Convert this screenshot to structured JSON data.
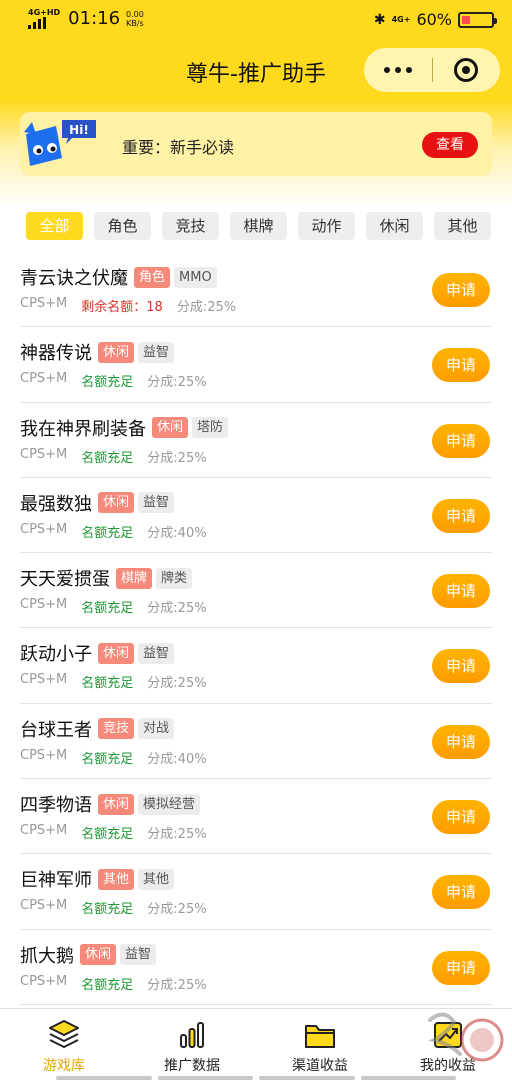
{
  "status_bar": {
    "network_label": "4G+HD",
    "time": "01:16",
    "speed_value": "0.00",
    "speed_unit": "KB/s",
    "right_network": "4G+",
    "battery_percent": "60%",
    "battery_level": 0.3
  },
  "nav": {
    "title": "尊牛-推广助手"
  },
  "notice": {
    "mascot_text": "Hi!",
    "text": "重要：新手必读",
    "button_label": "查看"
  },
  "tabs": [
    {
      "label": "全部",
      "active": true
    },
    {
      "label": "角色",
      "active": false
    },
    {
      "label": "竞技",
      "active": false
    },
    {
      "label": "棋牌",
      "active": false
    },
    {
      "label": "动作",
      "active": false
    },
    {
      "label": "休闲",
      "active": false
    },
    {
      "label": "其他",
      "active": false
    }
  ],
  "games": [
    {
      "name": "青云诀之伏魔",
      "category": "角色",
      "tag": "MMO",
      "model": "CPS+M",
      "quota": "剩余名额：18",
      "quota_status": "warn",
      "share": "分成:25%",
      "button": "申请"
    },
    {
      "name": "神器传说",
      "category": "休闲",
      "tag": "益智",
      "model": "CPS+M",
      "quota": "名额充足",
      "quota_status": "ok",
      "share": "分成:25%",
      "button": "申请"
    },
    {
      "name": "我在神界刷装备",
      "category": "休闲",
      "tag": "塔防",
      "model": "CPS+M",
      "quota": "名额充足",
      "quota_status": "ok",
      "share": "分成:25%",
      "button": "申请"
    },
    {
      "name": "最强数独",
      "category": "休闲",
      "tag": "益智",
      "model": "CPS+M",
      "quota": "名额充足",
      "quota_status": "ok",
      "share": "分成:40%",
      "button": "申请"
    },
    {
      "name": "天天爱掼蛋",
      "category": "棋牌",
      "tag": "牌类",
      "model": "CPS+M",
      "quota": "名额充足",
      "quota_status": "ok",
      "share": "分成:25%",
      "button": "申请"
    },
    {
      "name": "跃动小子",
      "category": "休闲",
      "tag": "益智",
      "model": "CPS+M",
      "quota": "名额充足",
      "quota_status": "ok",
      "share": "分成:25%",
      "button": "申请"
    },
    {
      "name": "台球王者",
      "category": "竞技",
      "tag": "对战",
      "model": "CPS+M",
      "quota": "名额充足",
      "quota_status": "ok",
      "share": "分成:40%",
      "button": "申请"
    },
    {
      "name": "四季物语",
      "category": "休闲",
      "tag": "模拟经营",
      "model": "CPS+M",
      "quota": "名额充足",
      "quota_status": "ok",
      "share": "分成:25%",
      "button": "申请"
    },
    {
      "name": "巨神军师",
      "category": "其他",
      "tag": "其他",
      "model": "CPS+M",
      "quota": "名额充足",
      "quota_status": "ok",
      "share": "分成:25%",
      "button": "申请"
    },
    {
      "name": "抓大鹅",
      "category": "休闲",
      "tag": "益智",
      "model": "CPS+M",
      "quota": "名额充足",
      "quota_status": "ok",
      "share": "分成:25%",
      "button": "申请"
    }
  ],
  "tabbar": [
    {
      "label": "游戏库",
      "icon": "stack-icon",
      "active": true
    },
    {
      "label": "推广数据",
      "icon": "bar-chart-icon",
      "active": false
    },
    {
      "label": "渠道收益",
      "icon": "folder-icon",
      "active": false
    },
    {
      "label": "我的收益",
      "icon": "trend-chart-icon",
      "active": false
    }
  ],
  "colors": {
    "brand_yellow": "#ffd91e",
    "apply_orange": "#ff9c00",
    "category_tag": "#f58a7a",
    "quota_ok": "#1c9a36",
    "quota_warn": "#d8332a",
    "view_button": "#e81111"
  }
}
